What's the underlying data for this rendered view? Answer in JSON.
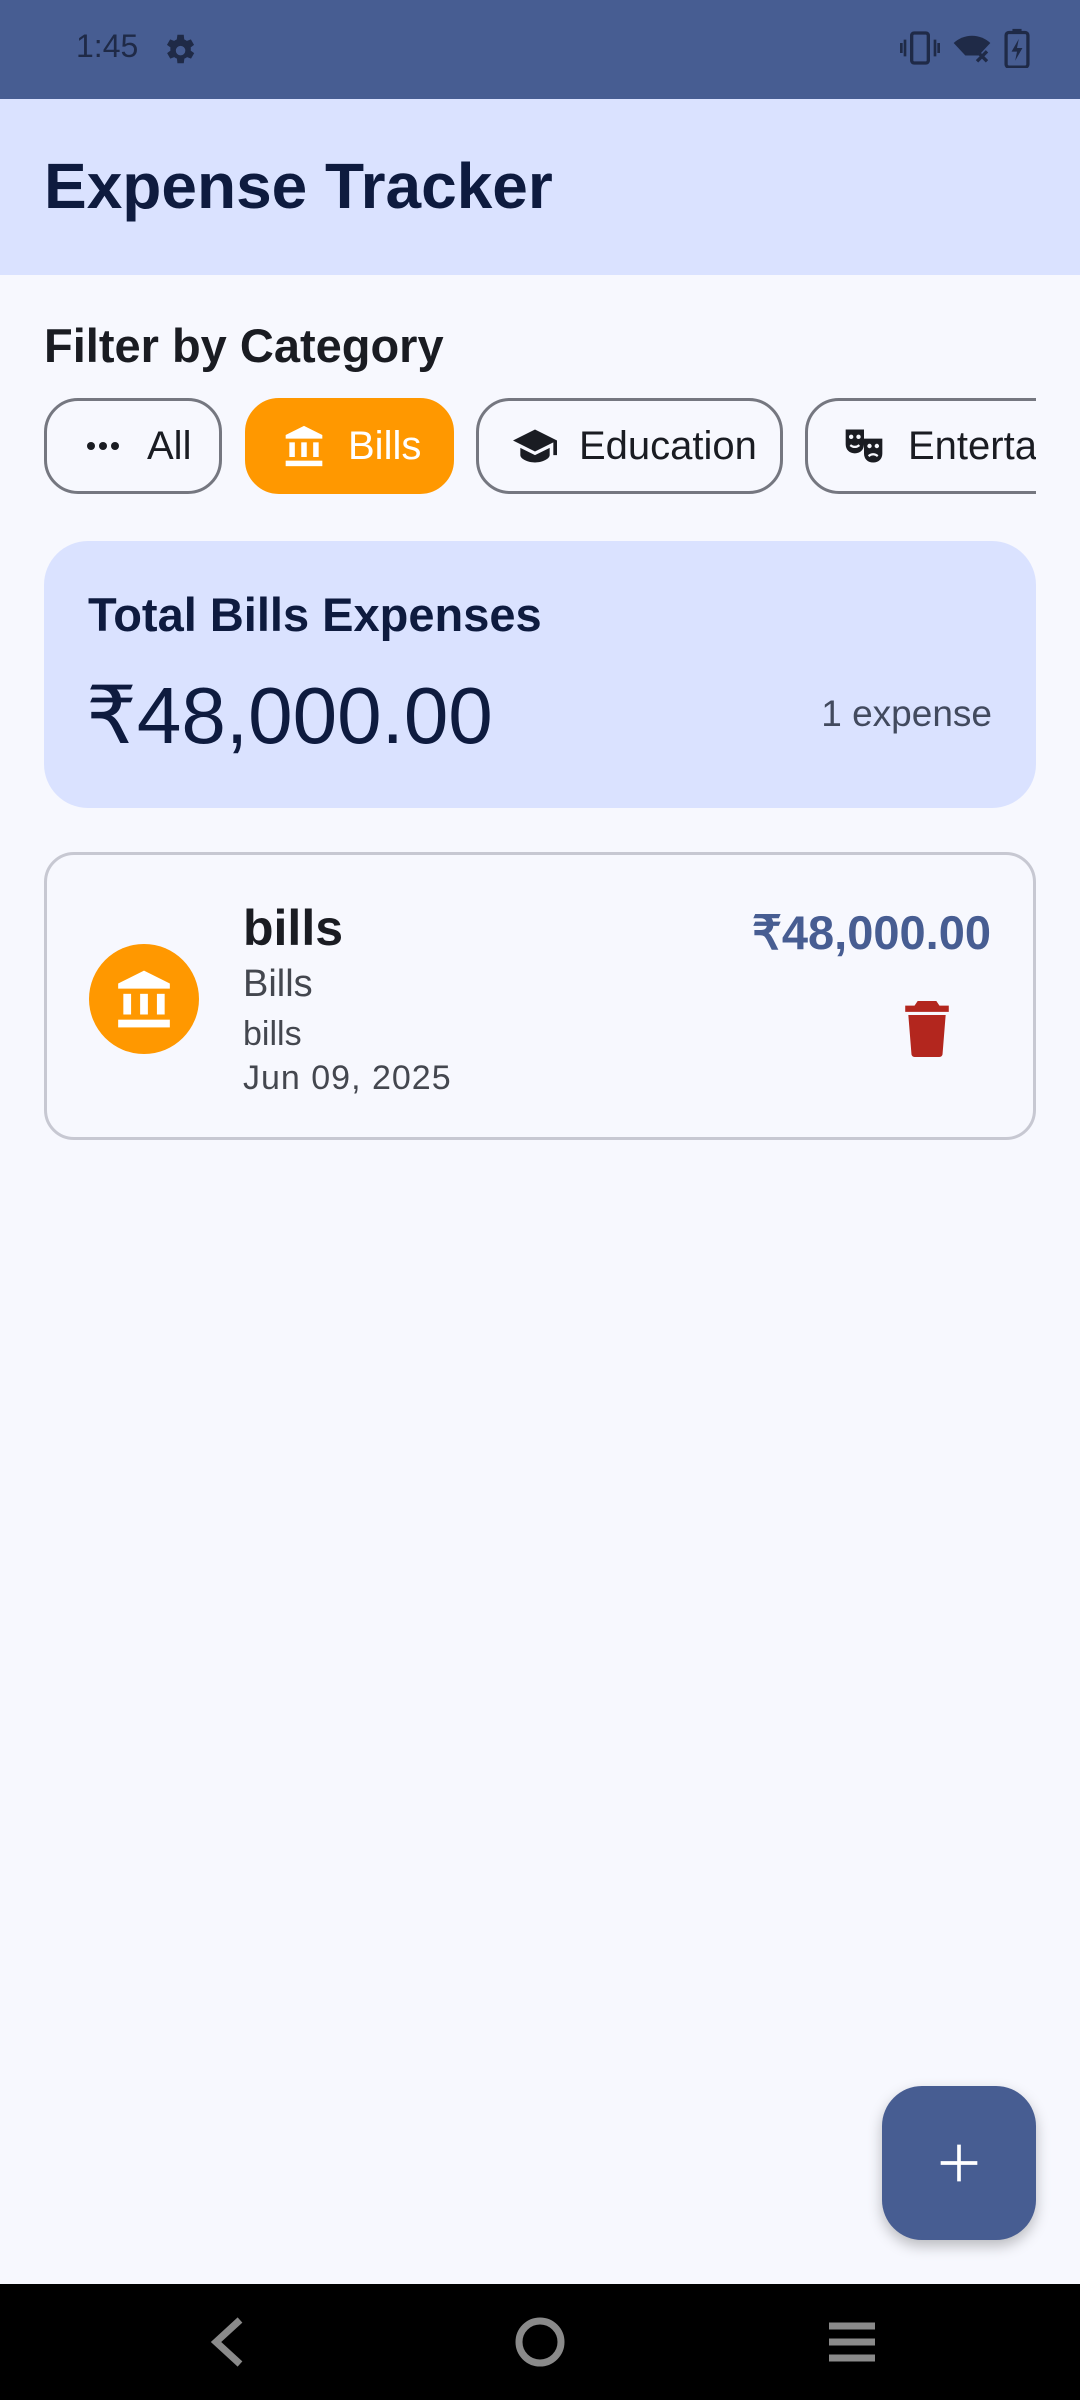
{
  "status_bar": {
    "time": "1:45",
    "icons": [
      "settings-icon",
      "vibrate-icon",
      "wifi-off-icon",
      "battery-charging-icon"
    ]
  },
  "app_bar": {
    "title": "Expense Tracker"
  },
  "filter": {
    "title": "Filter by Category",
    "chips": [
      {
        "label": "All",
        "icon": "more-horiz-icon",
        "selected": false
      },
      {
        "label": "Bills",
        "icon": "bank-icon",
        "selected": true
      },
      {
        "label": "Education",
        "icon": "school-icon",
        "selected": false
      },
      {
        "label": "Entertai",
        "icon": "theater-masks-icon",
        "selected": false
      }
    ]
  },
  "summary": {
    "title": "Total Bills Expenses",
    "amount": "₹48,000.00",
    "count": "1 expense"
  },
  "expenses": [
    {
      "title": "bills",
      "category": "Bills",
      "note": "bills",
      "date": "Jun 09, 2025",
      "amount": "₹48,000.00",
      "icon": "bank-icon"
    }
  ],
  "fab": {
    "label": "+",
    "icon": "add-icon"
  },
  "colors": {
    "primary": "#475d92",
    "primary_container": "#dae2ff",
    "accent": "#ff9800",
    "delete": "#b3261e",
    "background": "#f7f8fe"
  }
}
